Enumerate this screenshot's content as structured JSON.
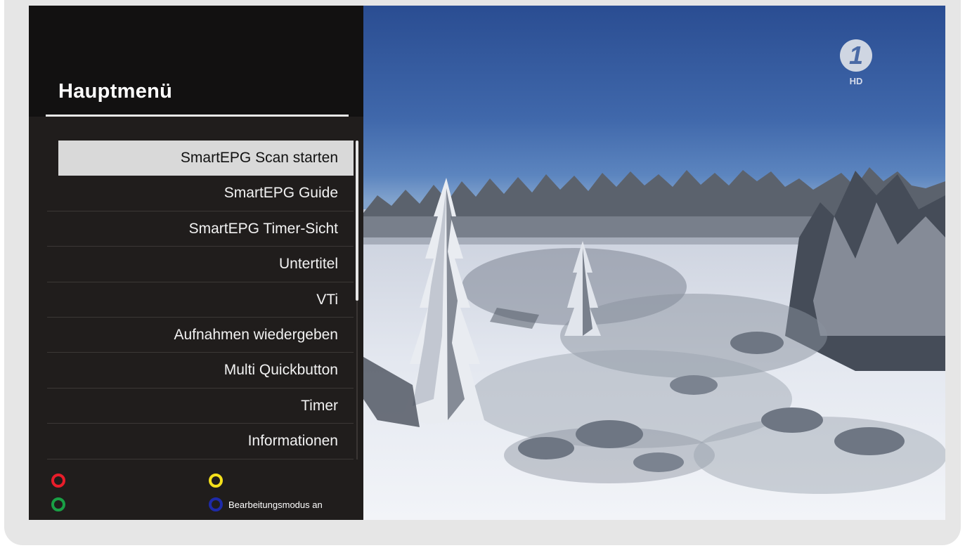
{
  "menu": {
    "title": "Hauptmenü",
    "selected_index": 0,
    "items": [
      {
        "label": "SmartEPG Scan starten"
      },
      {
        "label": "SmartEPG Guide"
      },
      {
        "label": "SmartEPG Timer-Sicht"
      },
      {
        "label": "Untertitel"
      },
      {
        "label": "VTi"
      },
      {
        "label": "Aufnahmen wiedergeben"
      },
      {
        "label": "Multi Quickbutton"
      },
      {
        "label": "Timer"
      },
      {
        "label": "Informationen"
      }
    ]
  },
  "color_keys": {
    "red": {
      "color": "#e81d2a",
      "label": ""
    },
    "yellow": {
      "color": "#f4e01b",
      "label": ""
    },
    "green": {
      "color": "#19a045",
      "label": ""
    },
    "blue": {
      "color": "#1e2aa8",
      "label": "Bearbeitungsmodus an"
    }
  },
  "channel": {
    "logo_icon": "das-erste-one-icon",
    "logo_text": "1",
    "badge": "HD"
  },
  "video": {
    "scene": "snowy-forest-image"
  }
}
